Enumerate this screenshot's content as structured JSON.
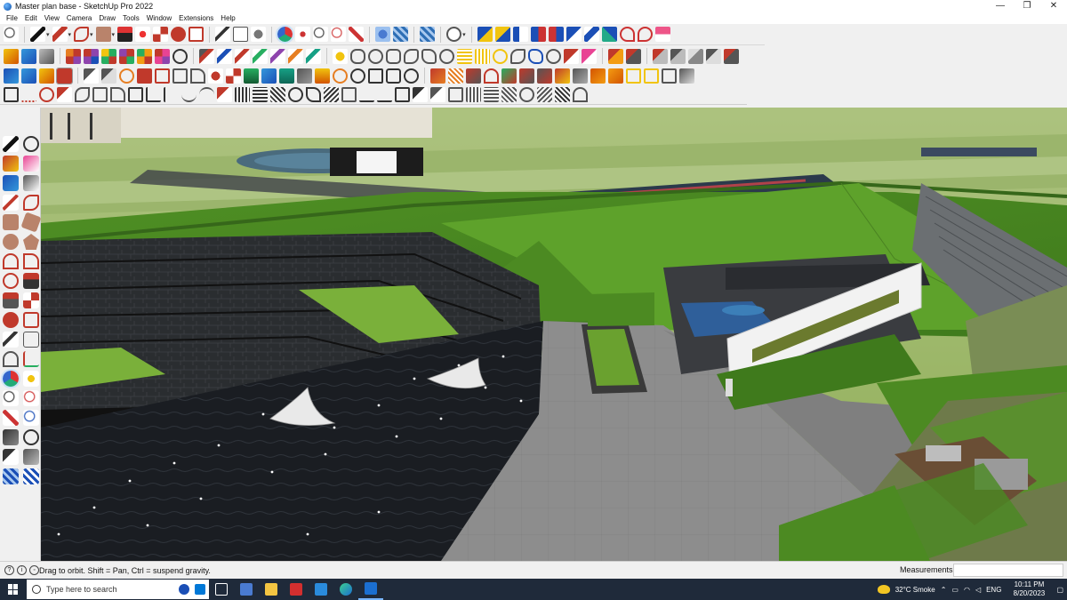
{
  "window": {
    "title": "Master plan base - SketchUp Pro 2022",
    "minimize": "—",
    "maximize": "❐",
    "close": "✕"
  },
  "menu": [
    "File",
    "Edit",
    "View",
    "Camera",
    "Draw",
    "Tools",
    "Window",
    "Extensions",
    "Help"
  ],
  "status": {
    "hint": "Drag to orbit. Shift = Pan, Ctrl = suspend gravity.",
    "measurements_label": "Measurements",
    "measurements_value": ""
  },
  "taskbar": {
    "search_placeholder": "Type here to search",
    "weather": "32°C  Smoke",
    "language": "ENG",
    "time": "10:11 PM",
    "date": "8/20/2023"
  },
  "colors": {
    "accent": "#0078d7",
    "titlebar_bg": "#ffffff",
    "toolbar_bg": "#f0f0f0",
    "taskbar_bg": "#1f2a3a",
    "grass": "#5a9a2a",
    "water": "#1b1e24",
    "paving": "#8e8e8e"
  },
  "icons": {
    "toolbar1": [
      "zoom-icon",
      "select-icon",
      "pencil-icon",
      "freehand-icon",
      "paint-bucket-icon",
      "push-pull-icon",
      "move-icon",
      "rotate-icon",
      "scale-icon",
      "offset-icon",
      "tape-measure-icon",
      "text-icon",
      "orbit-icon",
      "pan-icon",
      "zoom-window-icon",
      "zoom-extents-icon",
      "components-icon",
      "materials-icon",
      "styles-icon",
      "layers-icon",
      "geolocate-icon",
      "warehouse-icon",
      "extension-icon",
      "scenes-icon"
    ],
    "left_tools": [
      "select-icon",
      "orbit-icon",
      "paint-icon",
      "eraser-icon",
      "component-icon",
      "pencil-icon",
      "line-icon",
      "freehand-icon",
      "rectangle-icon",
      "rotated-rectangle-icon",
      "circle-icon",
      "polygon-icon",
      "arc-icon",
      "pie-icon",
      "push-pull-icon",
      "follow-me-icon",
      "move-icon",
      "scale-icon",
      "rotate-icon",
      "offset-icon",
      "tape-measure-icon",
      "text-icon",
      "protractor-icon",
      "axes-icon",
      "orbit-icon",
      "pan-icon",
      "zoom-icon",
      "zoom-window-icon",
      "zoom-extents-icon",
      "previous-view-icon",
      "walk-icon",
      "look-around-icon",
      "footprint-icon",
      "position-camera-icon",
      "section-plane-icon",
      "section-fill-icon"
    ]
  }
}
